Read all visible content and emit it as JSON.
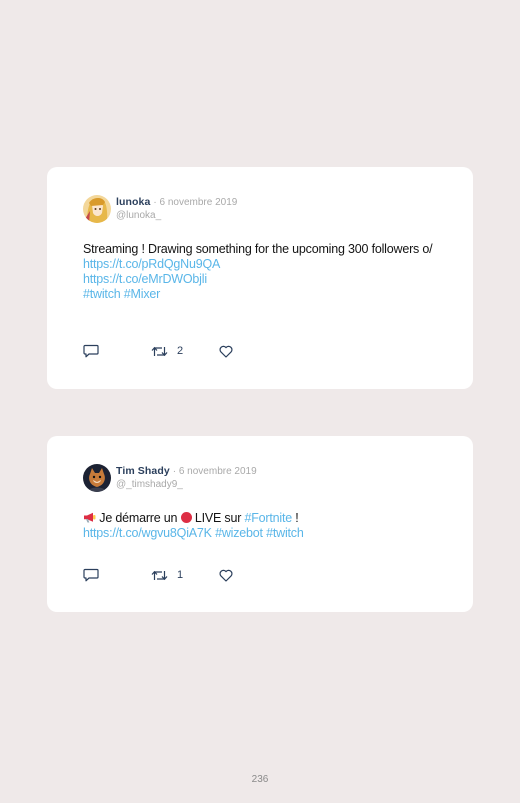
{
  "tweets": [
    {
      "name": "lunoka",
      "date": "· 6 novembre 2019",
      "handle": "@lunoka_",
      "text_line1": "Streaming ! Drawing something for the upcoming 300 followers o/",
      "link1": "https://t.co/pRdQgNu9QA",
      "link2": "https://t.co/eMrDWObjli",
      "hashtags": "#twitch #Mixer",
      "retweets": "2"
    },
    {
      "name": "Tim Shady",
      "date": "· 6 novembre 2019",
      "handle": "@_timshady9_",
      "text_before": " Je démarre un ",
      "text_live": " LIVE sur ",
      "hashtag_fortnite": "#Fortnite",
      "text_bang": " !",
      "link1": "https://t.co/wgvu8QiA7K",
      "hashtags": "#wizebot #twitch",
      "retweets": "1"
    }
  ],
  "page_number": "236",
  "colors": {
    "background": "#efe9e9",
    "link": "#5ab6e8",
    "name": "#2b3f5c"
  }
}
